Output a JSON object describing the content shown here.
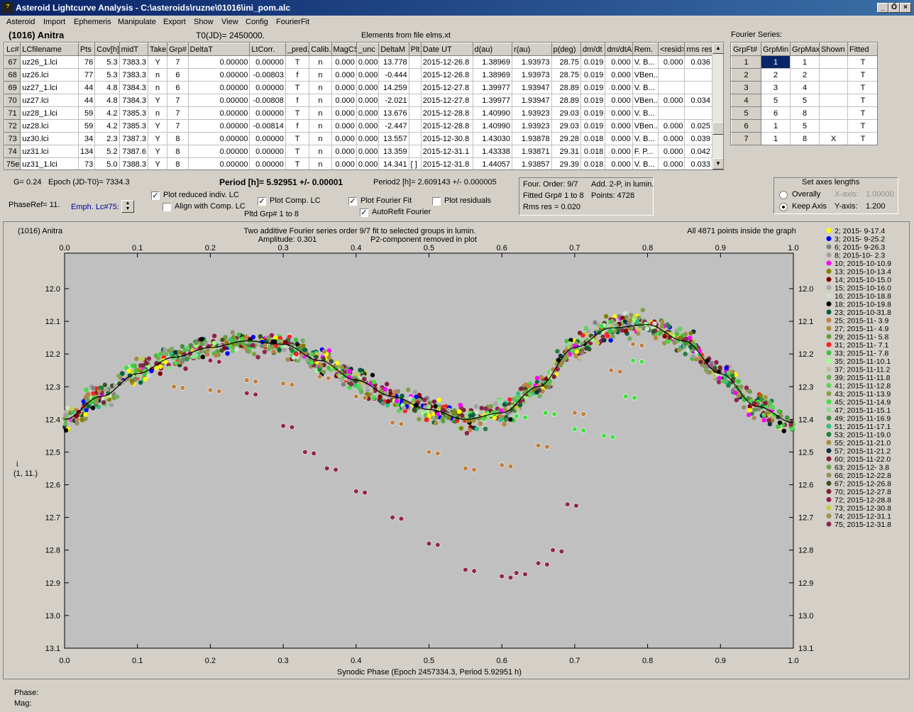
{
  "window": {
    "title": "Asteroid Lightcurve Analysis - C:\\asteroids\\ruzne\\01016\\ini_pom.alc",
    "icon": "app-logo-icon",
    "controls": [
      "_",
      "Ő",
      "×"
    ]
  },
  "menu": [
    "Asteroid",
    "Import",
    "Ephemeris",
    "Manipulate",
    "Export",
    "Show",
    "View",
    "Config",
    "FourierFit"
  ],
  "header": {
    "asteroid": "(1016) Anitra",
    "t0": "T0(JD)= 2450000.",
    "elements": "Elements from file elms.xt",
    "fourier_series_label": "Fourier Series:"
  },
  "lc_table": {
    "headers": [
      "Lc#",
      "LCfilename",
      "Pts",
      "Cov[h]",
      "midT",
      "Take",
      "Grp#",
      "DeltaT",
      "LtCorr.",
      "_pred.",
      "Calib.",
      "MagCS",
      "_unc",
      "DeltaM",
      "Plt",
      "Date UT",
      "d(au)",
      "r(au)",
      "p(deg)",
      "dm/dt",
      "dm/dtA",
      "Rem.",
      "<resid>",
      "rms res"
    ],
    "rows": [
      [
        "67",
        "uz26_1.lci",
        "76",
        "5.3",
        "7383.3",
        "Y",
        "7",
        "0.00000",
        "0.00000",
        "T",
        "n",
        "0.000",
        "0.000",
        "13.778",
        "",
        "2015-12-26.8",
        "1.38969",
        "1.93973",
        "28.75",
        "0.019",
        "0.000",
        "V. B...",
        "0.000",
        "0.036"
      ],
      [
        "68",
        "uz26.lci",
        "77",
        "5.3",
        "7383.3",
        "n",
        "6",
        "0.00000",
        "-0.00803",
        "f",
        "n",
        "0.000",
        "0.000",
        "-0.444",
        "",
        "2015-12-26.8",
        "1.38969",
        "1.93973",
        "28.75",
        "0.019",
        "0.000",
        "VBen...",
        "",
        ""
      ],
      [
        "69",
        "uz27_1.lci",
        "44",
        "4.8",
        "7384.3",
        "n",
        "6",
        "0.00000",
        "0.00000",
        "T",
        "n",
        "0.000",
        "0.000",
        "14.259",
        "",
        "2015-12-27.8",
        "1.39977",
        "1.93947",
        "28.89",
        "0.019",
        "0.000",
        "V. B...",
        "",
        ""
      ],
      [
        "70",
        "uz27.lci",
        "44",
        "4.8",
        "7384.3",
        "Y",
        "7",
        "0.00000",
        "-0.00808",
        "f",
        "n",
        "0.000",
        "0.000",
        "-2.021",
        "",
        "2015-12-27.8",
        "1.39977",
        "1.93947",
        "28.89",
        "0.019",
        "0.000",
        "VBen...",
        "0.000",
        "0.034"
      ],
      [
        "71",
        "uz28_1.lci",
        "59",
        "4.2",
        "7385.3",
        "n",
        "7",
        "0.00000",
        "0.00000",
        "T",
        "n",
        "0.000",
        "0.000",
        "13.676",
        "",
        "2015-12-28.8",
        "1.40990",
        "1.93923",
        "29.03",
        "0.019",
        "0.000",
        "V. B...",
        "",
        ""
      ],
      [
        "72",
        "uz28.lci",
        "59",
        "4.2",
        "7385.3",
        "Y",
        "7",
        "0.00000",
        "-0.00814",
        "f",
        "n",
        "0.000",
        "0.000",
        "-2.447",
        "",
        "2015-12-28.8",
        "1.40990",
        "1.93923",
        "29.03",
        "0.019",
        "0.000",
        "VBen...",
        "0.000",
        "0.025"
      ],
      [
        "73",
        "uz30.lci",
        "34",
        "2.3",
        "7387.3",
        "Y",
        "8",
        "0.00000",
        "0.00000",
        "T",
        "n",
        "0.000",
        "0.000",
        "13.557",
        "",
        "2015-12-30.8",
        "1.43030",
        "1.93878",
        "29.28",
        "0.018",
        "0.000",
        "V. B...",
        "0.000",
        "0.039"
      ],
      [
        "74",
        "uz31.lci",
        "134",
        "5.2",
        "7387.6",
        "Y",
        "8",
        "0.00000",
        "0.00000",
        "T",
        "n",
        "0.000",
        "0.000",
        "13.359",
        "",
        "2015-12-31.1",
        "1.43338",
        "1.93871",
        "29.31",
        "0.018",
        "0.000",
        "F. P...",
        "0.000",
        "0.042"
      ],
      [
        "75e",
        "uz31_1.lci",
        "73",
        "5.0",
        "7388.3",
        "Y",
        "8",
        "0.00000",
        "0.00000",
        "T",
        "n",
        "0.000",
        "0.000",
        "14.341",
        "[ ]",
        "2015-12-31.8",
        "1.44057",
        "1.93857",
        "29.39",
        "0.018",
        "0.000",
        "V. B...",
        "0.000",
        "0.033"
      ]
    ]
  },
  "fourier_table": {
    "headers": [
      "GrpFt#",
      "GrpMin",
      "GrpMax",
      "Shown",
      "Fitted"
    ],
    "rows": [
      [
        "1",
        "1",
        "1",
        "",
        "T"
      ],
      [
        "2",
        "2",
        "2",
        "",
        "T"
      ],
      [
        "3",
        "3",
        "4",
        "",
        "T"
      ],
      [
        "4",
        "5",
        "5",
        "",
        "T"
      ],
      [
        "5",
        "6",
        "8",
        "",
        "T"
      ],
      [
        "6",
        "1",
        "5",
        "",
        "T"
      ],
      [
        "7",
        "1",
        "8",
        "X",
        "T"
      ]
    ]
  },
  "controls": {
    "g": "G= 0.24",
    "epoch": "Epoch (JD-T0)= 7334.3",
    "period": "Period [h]= 5.92951 +/- 0.00001",
    "period2": "Period2 [h]= 2.609143 +/- 0.000005",
    "phaseref": "PhaseRef= 11.",
    "emph": "Emph. Lc#75:",
    "plot_reduced": "Plot reduced indiv. LC",
    "align": "Align with Comp. LC",
    "plot_comp": "Plot Comp. LC",
    "pltd_grp": "Pltd Grp#  1   to    8",
    "plot_fourier": "Plot Fourier Fit",
    "autorefit": "AutoRefit Fourier",
    "plot_residuals": "Plot residuals",
    "four_order": "Four. Order:  9/7",
    "add2p": "Add. 2-P, in lumin.",
    "fitted_grp": "Fitted Grp# 1 to 8",
    "points": "Points: 4728",
    "rms": "Rms res     = 0.020",
    "axes_title": "Set axes lengths",
    "overally": "Overally",
    "keep_axis": "Keep Axis",
    "xaxis_lbl": "X-axis:",
    "xaxis_val": "1.00000",
    "yaxis_lbl": "Y-axis:",
    "yaxis_val": "1.200"
  },
  "plot": {
    "corner_title": "(1016) Anitra",
    "title1": "Two additive Fourier series order 9/7 fit to selected groups in lumin.",
    "title2": "Amplitude: 0.301",
    "title3": "P2-component removed in plot",
    "inside": "All 4871 points inside the graph",
    "xlabel": "Synodic Phase (Epoch 2457334.3, Period 5.92951 h)",
    "ylabel1": "i",
    "ylabel2": "(1, 11.)",
    "x_ticks": [
      "0.0",
      "0.1",
      "0.2",
      "0.3",
      "0.4",
      "0.5",
      "0.6",
      "0.7",
      "0.8",
      "0.9",
      "1.0"
    ],
    "y_ticks": [
      "12.0",
      "12.1",
      "12.2",
      "12.3",
      "12.4",
      "12.5",
      "12.6",
      "12.7",
      "12.8",
      "12.9",
      "13.0",
      "13.1"
    ]
  },
  "legend": [
    {
      "label": "2; 2015- 9-17.4",
      "color": "#ffff00"
    },
    {
      "label": "3; 2015- 9-25.2",
      "color": "#0000ff"
    },
    {
      "label": "6; 2015- 9-26.3",
      "color": "#808080"
    },
    {
      "label": "8; 2015-10- 2.3",
      "color": "#a0a0a0"
    },
    {
      "label": "10; 2015-10-10.9",
      "color": "#ff00ff"
    },
    {
      "label": "13; 2015-10-13.4",
      "color": "#808000"
    },
    {
      "label": "14; 2015-10-15.0",
      "color": "#800000"
    },
    {
      "label": "15; 2015-10-16.0",
      "color": "#a8a8a8"
    },
    {
      "label": "16; 2015-10-18.8",
      "color": "#d0e0d0"
    },
    {
      "label": "18; 2015-10-19.8",
      "color": "#000000"
    },
    {
      "label": "23; 2015-10-31.8",
      "color": "#006040"
    },
    {
      "label": "25; 2015-11- 3.9",
      "color": "#c08040"
    },
    {
      "label": "27; 2015-11- 4.9",
      "color": "#b08a40"
    },
    {
      "label": "29; 2015-11- 5.8",
      "color": "#60a040"
    },
    {
      "label": "31; 2015-11- 7.1",
      "color": "#ff2020"
    },
    {
      "label": "33; 2015-11- 7.8",
      "color": "#40c040"
    },
    {
      "label": "35; 2015-11-10.1",
      "color": "#a0ff80"
    },
    {
      "label": "37; 2015-11-11.2",
      "color": "#c0c0a0"
    },
    {
      "label": "39; 2015-11-11.8",
      "color": "#70b060"
    },
    {
      "label": "41; 2015-11-12.8",
      "color": "#60d060"
    },
    {
      "label": "43; 2015-11-13.9",
      "color": "#80a040"
    },
    {
      "label": "45; 2015-11-14.9",
      "color": "#40e040"
    },
    {
      "label": "47; 2015-11-15.1",
      "color": "#90e090"
    },
    {
      "label": "49; 2015-11-16.9",
      "color": "#409040"
    },
    {
      "label": "51; 2015-11-17.1",
      "color": "#30c080"
    },
    {
      "label": "53; 2015-11-19.0",
      "color": "#208040"
    },
    {
      "label": "55; 2015-11-21.0",
      "color": "#a09040"
    },
    {
      "label": "57; 2015-11-21.2",
      "color": "#103040"
    },
    {
      "label": "60; 2015-11-22.0",
      "color": "#802040"
    },
    {
      "label": "63; 2015-12- 3.8",
      "color": "#70a050"
    },
    {
      "label": "66; 2015-12-22.8",
      "color": "#909060"
    },
    {
      "label": "67; 2015-12-26.8",
      "color": "#405020"
    },
    {
      "label": "70; 2015-12-27.8",
      "color": "#802030"
    },
    {
      "label": "72; 2015-12-28.8",
      "color": "#902050"
    },
    {
      "label": "73; 2015-12-30.8",
      "color": "#c0d040"
    },
    {
      "label": "74; 2015-12-31.1",
      "color": "#a09050"
    },
    {
      "label": "75; 2015-12-31.8",
      "color": "#902850"
    }
  ],
  "status": {
    "phase": "Phase:",
    "mag": "Mag:"
  },
  "chart_data": {
    "type": "scatter",
    "xlabel": "Synodic Phase (Epoch 2457334.3, Period 5.92951 h)",
    "ylabel": "i",
    "xlim": [
      0,
      1
    ],
    "ylim": [
      12.0,
      13.1
    ],
    "y_inverted": true,
    "fourier_fit": {
      "x": [
        0,
        0.05,
        0.1,
        0.15,
        0.2,
        0.25,
        0.3,
        0.35,
        0.4,
        0.45,
        0.5,
        0.55,
        0.6,
        0.65,
        0.7,
        0.75,
        0.8,
        0.85,
        0.9,
        0.95,
        1.0
      ],
      "y": [
        12.4,
        12.33,
        12.26,
        12.21,
        12.18,
        12.16,
        12.17,
        12.22,
        12.28,
        12.33,
        12.37,
        12.4,
        12.38,
        12.3,
        12.18,
        12.12,
        12.11,
        12.16,
        12.26,
        12.36,
        12.41
      ]
    },
    "series": [
      {
        "name": "25; 2015-11- 3.9",
        "color": "#c08040",
        "x": [
          0.15,
          0.2,
          0.25,
          0.3,
          0.35,
          0.4,
          0.45,
          0.5,
          0.55,
          0.6,
          0.65,
          0.7,
          0.75,
          0.78
        ],
        "y": [
          12.3,
          12.31,
          12.28,
          12.29,
          12.27,
          12.33,
          12.41,
          12.5,
          12.55,
          12.54,
          12.48,
          12.38,
          12.25,
          12.17
        ]
      },
      {
        "name": "75; 2015-12-31.8",
        "color": "#902850",
        "x": [
          0.2,
          0.25,
          0.3,
          0.33,
          0.36,
          0.4,
          0.45,
          0.5,
          0.55,
          0.6,
          0.62,
          0.65,
          0.67,
          0.69
        ],
        "y": [
          12.22,
          12.32,
          12.42,
          12.5,
          12.55,
          12.62,
          12.7,
          12.78,
          12.86,
          12.88,
          12.87,
          12.84,
          12.8,
          12.66
        ]
      },
      {
        "name": "45; 2015-11-14.9",
        "color": "#40e040",
        "x": [
          0.62,
          0.66,
          0.7,
          0.74,
          0.77,
          0.78
        ],
        "y": [
          12.39,
          12.38,
          12.43,
          12.45,
          12.33,
          12.22
        ]
      }
    ]
  }
}
